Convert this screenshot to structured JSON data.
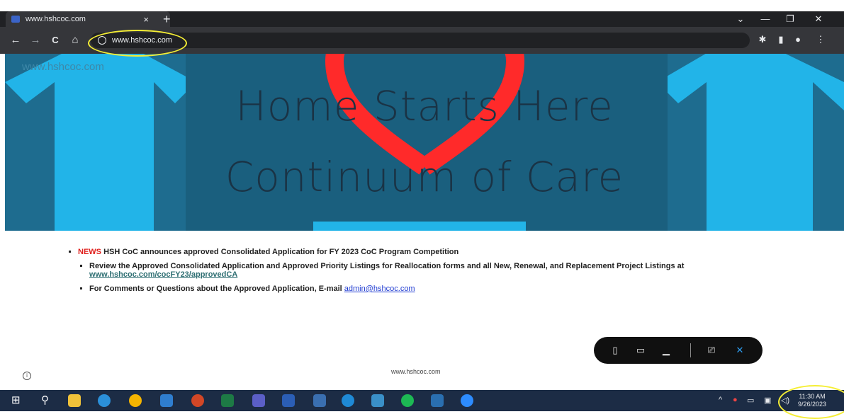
{
  "browser": {
    "tab_title": "www.hshcoc.com",
    "tab_close": "×",
    "new_tab": "+",
    "url": "www.hshcoc.com",
    "minimize": "—",
    "restore": "❐",
    "close": "✕",
    "tab_list": "⌄",
    "back": "←",
    "forward": "→",
    "reload": "C",
    "home": "⌂",
    "extensions_icon": "✱",
    "sidepanel_icon": "▮",
    "profile_icon": "●",
    "menu_icon": "⋮"
  },
  "hero": {
    "watermark": "www.hshcoc.com",
    "title_line1": "Home Starts Here",
    "title_line2": "Continuum of Care",
    "colors": {
      "background": "#1e6c8f",
      "accent": "#22b4e8",
      "heart": "#ff2a2a",
      "title": "#1a3345"
    }
  },
  "news": {
    "tag": "NEWS",
    "headline": "HSH CoC announces approved Consolidated Application for FY 2023 CoC Program Competition",
    "item1_text": "Review the Approved Consolidated Application and Approved Priority Listings for Reallocation forms and all New, Renewal, and Replacement Project Listings at",
    "item1_link": "www.hshcoc.com/cocFY23/approvedCA",
    "item2_text": "For Comments or Questions about the Approved Application, E-mail",
    "item2_link": "admin@hshcoc.com"
  },
  "footer": {
    "text": "www.hshcoc.com",
    "info_icon": "i"
  },
  "viewbar": {
    "phone": "▯",
    "tablet": "▭",
    "laptop": "▁",
    "feedback": "⎚",
    "close": "✕"
  },
  "taskbar": {
    "start": "⊞",
    "search": "⚲",
    "time": "11:30 AM",
    "date": "9/26/2023",
    "tray_chevron": "^"
  }
}
